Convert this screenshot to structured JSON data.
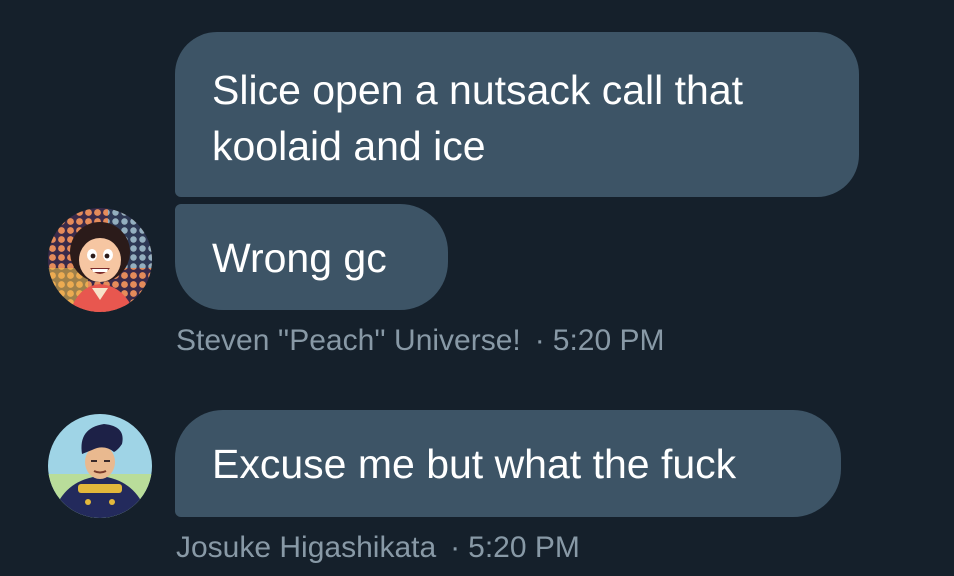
{
  "colors": {
    "background": "#15202b",
    "bubble": "#3d5466",
    "bubble_text": "#ffffff",
    "meta_text": "#8899a6"
  },
  "messages": [
    {
      "text": "Slice open a nutsack call that koolaid and ice"
    },
    {
      "text": "Wrong gc",
      "sender": "Steven ''Peach'' Universe!",
      "time": "5:20 PM",
      "avatar_icon": "steven-universe-avatar-icon"
    },
    {
      "text": "Excuse me but what the fuck",
      "sender": "Josuke Higashikata",
      "time": "5:20 PM",
      "avatar_icon": "josuke-avatar-icon"
    }
  ],
  "separator": "·"
}
